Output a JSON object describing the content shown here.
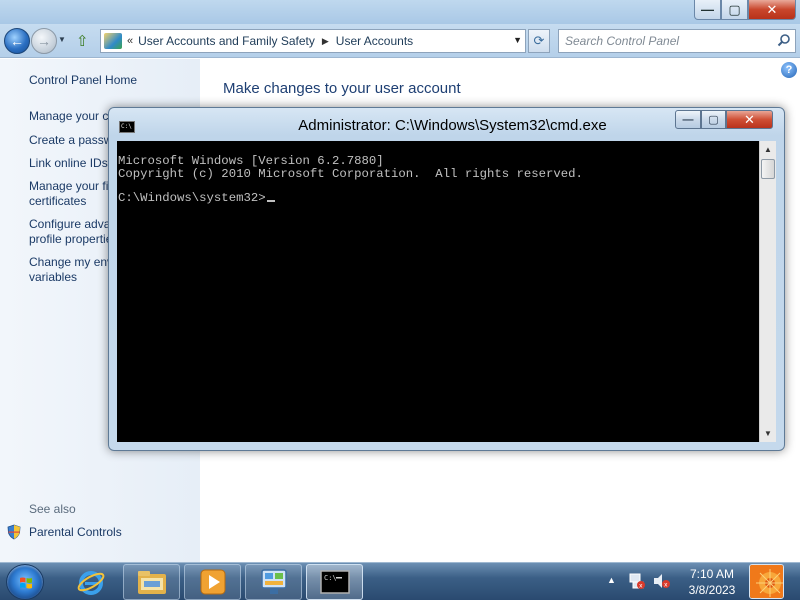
{
  "control_panel": {
    "window_controls": {
      "minimize": "—",
      "maximize": "▢",
      "close": "✕"
    },
    "address_chevron": "«",
    "breadcrumbs": [
      "User Accounts and Family Safety",
      "User Accounts"
    ],
    "search_placeholder": "Search Control Panel",
    "sidebar": {
      "home": "Control Panel Home",
      "items": [
        "Manage your c",
        "Create a passw",
        "Link online IDs",
        "Manage your fil\ncertificates",
        "Configure advan\nprofile properties",
        "Change my envi\nvariables"
      ],
      "see_also": "See also",
      "parental_controls": "Parental Controls"
    },
    "heading": "Make changes to your user account",
    "help_glyph": "?"
  },
  "cmd": {
    "title": "Administrator: C:\\Windows\\System32\\cmd.exe",
    "window_controls": {
      "minimize": "—",
      "maximize": "▢",
      "close": "✕"
    },
    "lines": [
      "Microsoft Windows [Version 6.2.7880]",
      "Copyright (c) 2010 Microsoft Corporation.  All rights reserved.",
      "",
      "C:\\Windows\\system32>"
    ]
  },
  "taskbar": {
    "pinned": [
      "ie-icon",
      "explorer-icon",
      "media-player-icon",
      "control-panel-icon",
      "cmd-icon"
    ],
    "active": "cmd-icon",
    "clock_time": "7:10 AM",
    "clock_date": "3/8/2023"
  },
  "colors": {
    "console_bg": "#000000",
    "console_fg": "#c0c0c0",
    "link": "#1b3a66",
    "heading": "#1e3f73"
  }
}
